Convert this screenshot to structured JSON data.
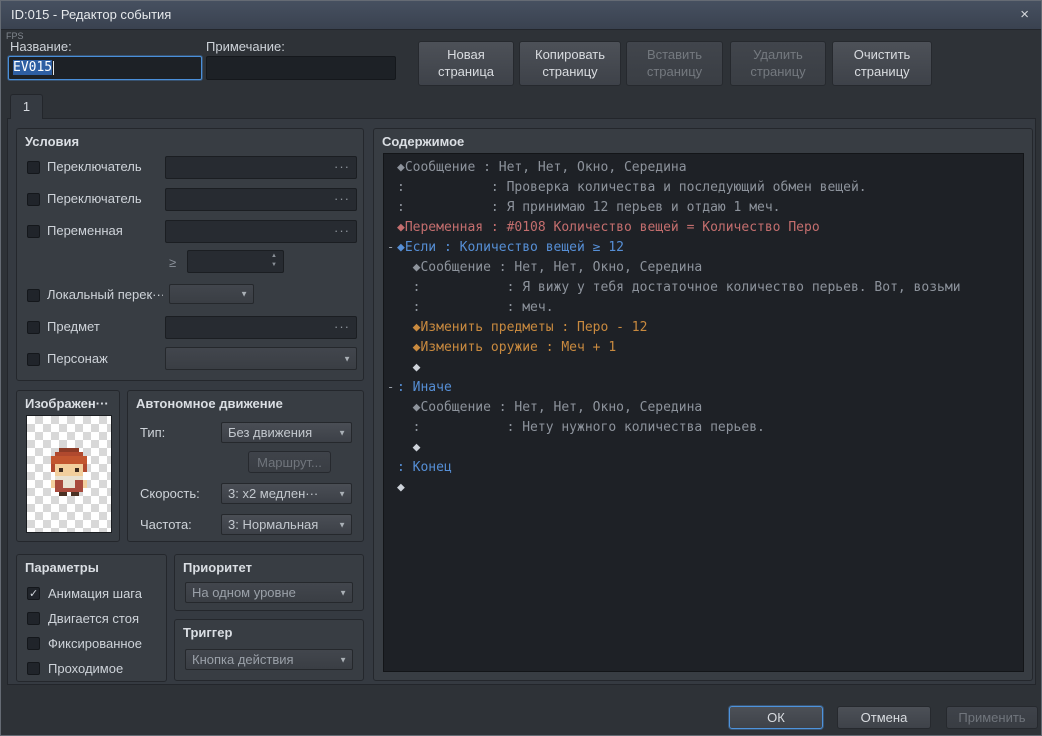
{
  "window": {
    "title": "ID:015 - Редактор события",
    "close": "×",
    "fps": "FPS"
  },
  "header": {
    "name_label": "Название:",
    "name_value": "EV015",
    "note_label": "Примечание:",
    "note_value": ""
  },
  "page_buttons": [
    {
      "label": "Новая страница",
      "enabled": true
    },
    {
      "label": "Копировать страницу",
      "enabled": true
    },
    {
      "label": "Вставить страницу",
      "enabled": false
    },
    {
      "label": "Удалить страницу",
      "enabled": false
    },
    {
      "label": "Очистить страницу",
      "enabled": true
    }
  ],
  "tab": {
    "label": "1"
  },
  "conditions": {
    "title": "Условия",
    "switch1_label": "Переключатель",
    "switch2_label": "Переключатель",
    "variable_label": "Переменная",
    "gte_symbol": "≥",
    "self_switch_label": "Локальный перек···",
    "item_label": "Предмет",
    "actor_label": "Персонаж",
    "ellipsis": "···"
  },
  "image": {
    "title": "Изображен···"
  },
  "autonomous": {
    "title": "Автономное движение",
    "type_label": "Тип:",
    "type_value": "Без движения",
    "route_button": "Маршрут...",
    "speed_label": "Скорость:",
    "speed_value": "3: x2 медлен···",
    "freq_label": "Частота:",
    "freq_value": "3: Нормальная"
  },
  "options": {
    "title": "Параметры",
    "items": [
      {
        "label": "Анимация шага",
        "checked": true
      },
      {
        "label": "Двигается стоя",
        "checked": false
      },
      {
        "label": "Фиксированное",
        "checked": false
      },
      {
        "label": "Проходимое",
        "checked": false
      }
    ]
  },
  "priority": {
    "title": "Приоритет",
    "value": "На одном уровне"
  },
  "trigger": {
    "title": "Триггер",
    "value": "Кнопка действия"
  },
  "contents": {
    "title": "Содержимое",
    "lines": [
      {
        "gutter": "",
        "color": "message",
        "text": "◆Сообщение : Нет, Нет, Окно, Середина"
      },
      {
        "gutter": "",
        "color": "message",
        "text": ":           : Проверка количества и последующий обмен вещей."
      },
      {
        "gutter": "",
        "color": "message",
        "text": ":           : Я принимаю 12 перьев и отдаю 1 меч."
      },
      {
        "gutter": "",
        "color": "variable",
        "text": "◆Переменная : #0108 Количество вещей = Количество Перо"
      },
      {
        "gutter": "-",
        "color": "flow",
        "text": "◆Если : Количество вещей ≥ 12"
      },
      {
        "gutter": "",
        "color": "message",
        "text": "  ◆Сообщение : Нет, Нет, Окно, Середина"
      },
      {
        "gutter": "",
        "color": "message",
        "text": "  :           : Я вижу у тебя достаточное количество перьев. Вот, возьми"
      },
      {
        "gutter": "",
        "color": "message",
        "text": "  :           : меч."
      },
      {
        "gutter": "",
        "color": "item",
        "text": "  ◆Изменить предметы : Перо - 12"
      },
      {
        "gutter": "",
        "color": "item",
        "text": "  ◆Изменить оружие : Меч + 1"
      },
      {
        "gutter": "",
        "color": "plain",
        "text": "  ◆"
      },
      {
        "gutter": "-",
        "color": "flow",
        "text": ": Иначе"
      },
      {
        "gutter": "",
        "color": "message",
        "text": "  ◆Сообщение : Нет, Нет, Окно, Середина"
      },
      {
        "gutter": "",
        "color": "message",
        "text": "  :           : Нету нужного количества перьев."
      },
      {
        "gutter": "",
        "color": "plain",
        "text": "  ◆"
      },
      {
        "gutter": "",
        "color": "flow",
        "text": ": Конец"
      },
      {
        "gutter": "",
        "color": "plain",
        "text": "◆"
      }
    ]
  },
  "footer": {
    "ok": {
      "label": "ОК",
      "enabled": true
    },
    "cancel": {
      "label": "Отмена",
      "enabled": true
    },
    "apply": {
      "label": "Применить",
      "enabled": false
    }
  },
  "colors": {
    "accent_selection": "#2e5fa3",
    "focus_border": "#4a8fd9",
    "cmd_message": "#8d939c",
    "cmd_variable": "#c46e6e",
    "cmd_flow": "#568fd6",
    "cmd_item": "#c98a3f",
    "cmd_plain": "#ced3da"
  }
}
